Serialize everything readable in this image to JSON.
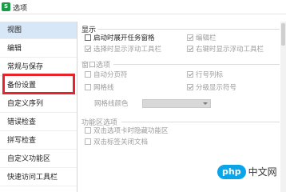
{
  "window": {
    "title": "选项",
    "app_icon_glyph": "S",
    "app_icon_color": "#1c9a4a"
  },
  "sidebar": {
    "items": [
      {
        "label": "视图",
        "active": true
      },
      {
        "label": "编辑"
      },
      {
        "label": "常规与保存"
      },
      {
        "label": "备份设置",
        "highlighted": true
      },
      {
        "label": "自定义序列"
      },
      {
        "label": "错误检查"
      },
      {
        "label": "拼写检查"
      },
      {
        "label": "自定义功能区"
      },
      {
        "label": "快速访问工具栏"
      }
    ],
    "highlight_color": "#e8232a",
    "active_color": "#d7e7f7"
  },
  "display": {
    "title": "显示",
    "options": [
      {
        "label": "启动时展开任务窗格",
        "checked": false,
        "disabled": false
      },
      {
        "label": "编辑栏",
        "checked": true,
        "disabled": true
      },
      {
        "label": "选择时显示浮动工具栏",
        "checked": true,
        "disabled": true
      },
      {
        "label": "右键时显示浮动工具栏",
        "checked": true,
        "disabled": true
      }
    ]
  },
  "window_options": {
    "title": "窗口选项",
    "options": [
      {
        "label": "自动分页符",
        "checked": false,
        "disabled": true
      },
      {
        "label": "行号列标",
        "checked": true,
        "disabled": true
      },
      {
        "label": "网格线",
        "checked": false,
        "disabled": true
      },
      {
        "label": "分级显示符号",
        "checked": true,
        "disabled": true
      }
    ],
    "gridline_color_label": "网格线颜色",
    "gridline_color_value": ""
  },
  "ribbon": {
    "title": "功能区选项",
    "options": [
      {
        "label": "双击选项卡时隐藏功能区",
        "checked": false,
        "disabled": true
      },
      {
        "label": "双击标签关闭文档",
        "checked": false,
        "disabled": true
      }
    ]
  },
  "watermark": {
    "logo": "php",
    "text": "中文网",
    "logo_color": "#0aa5e8"
  }
}
